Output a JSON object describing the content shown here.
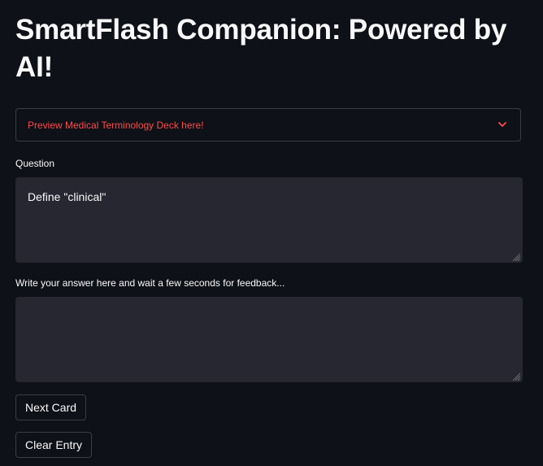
{
  "page": {
    "title": "SmartFlash Companion: Powered by AI!"
  },
  "expander": {
    "label": "Preview Medical Terminology Deck here!",
    "icon": "chevron-down-icon",
    "accent_color": "#ff4b4b"
  },
  "question": {
    "label": "Question",
    "value": "Define \"clinical\""
  },
  "answer": {
    "label": "Write your answer here and wait a few seconds for feedback...",
    "value": ""
  },
  "buttons": {
    "next_card": "Next Card",
    "clear_entry": "Clear Entry"
  },
  "theme": {
    "background": "#0e1117",
    "input_background": "#262730",
    "border": "#3a3d47",
    "text": "#fafafa"
  }
}
